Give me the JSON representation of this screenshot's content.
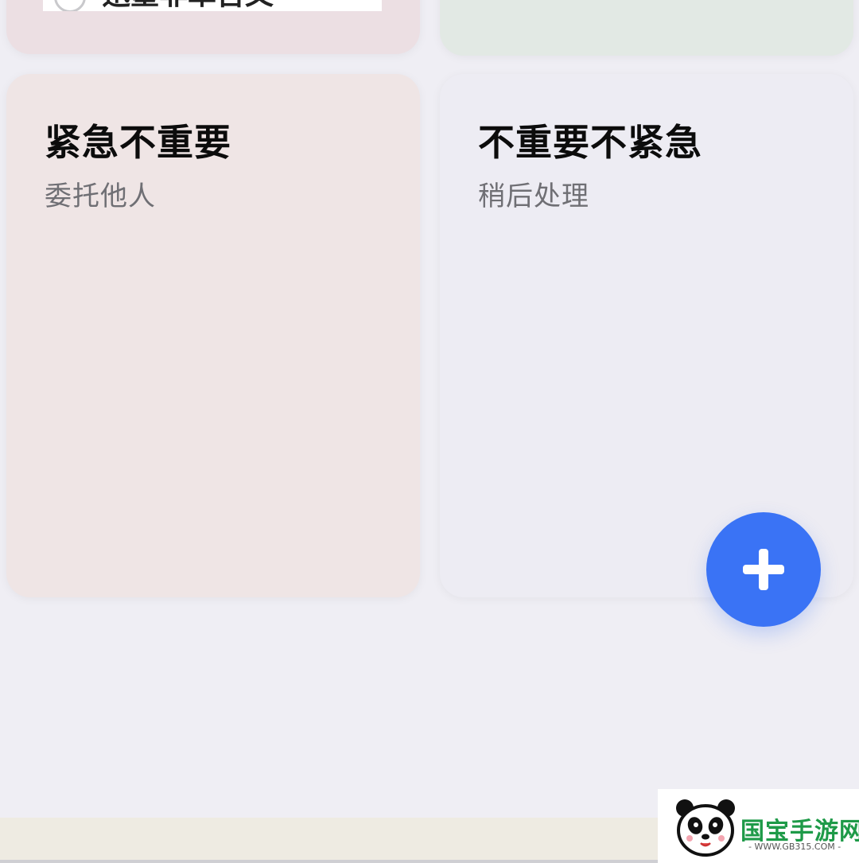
{
  "quadrants": {
    "top_left": {
      "task_text": "迅墨非阜吉文"
    },
    "bottom_left": {
      "title": "紧急不重要",
      "subtitle": "委托他人"
    },
    "bottom_right": {
      "title": "不重要不紧急",
      "subtitle": "稍后处理"
    }
  },
  "fab": {
    "icon": "plus-icon"
  },
  "watermark": {
    "text": "国宝手游网",
    "url": "- WWW.GB315.COM -"
  },
  "colors": {
    "background": "#efeef4",
    "card_urgent_not_important": "#efe5e5",
    "card_not_urgent_not_important": "#edecf3",
    "card_top_left": "#ecdfe3",
    "card_top_right": "#e2e9e4",
    "accent": "#3a73f5"
  }
}
